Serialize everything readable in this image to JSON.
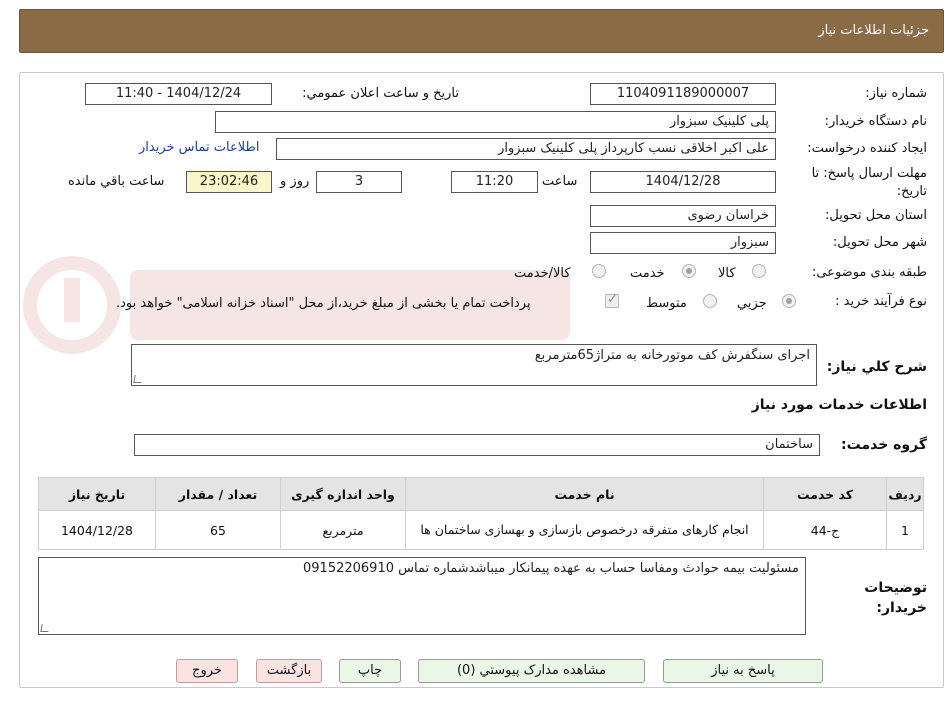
{
  "header": {
    "title": "جزئیات اطلاعات نیاز"
  },
  "fields": {
    "need_number_label": "شماره نیاز:",
    "need_number": "1104091189000007",
    "announce_label": "تاریخ و ساعت اعلان عمومي:",
    "announce_value": "1404/12/24 - 11:40",
    "buyer_org_label": "نام دستگاه خریدار:",
    "buyer_org": "پلی کلینیک سبزوار",
    "requester_label": "ایجاد کننده درخواست:",
    "requester": "علی اکبر اخلاقی نسب کارپرداز پلی کلینیک سبزوار",
    "contact_link": "اطلاعات تماس خریدار",
    "deadline_label": "مهلت ارسال پاسخ: تا تاریخ:",
    "deadline_date": "1404/12/28",
    "time_label": "ساعت",
    "deadline_time": "11:20",
    "days_value": "3",
    "days_label": "روز و",
    "remaining_time": "23:02:46",
    "remaining_label": "ساعت باقي مانده",
    "province_label": "استان محل تحویل:",
    "province": "خراسان رضوی",
    "city_label": "شهر محل تحویل:",
    "city": "سبزوار",
    "category_label": "طبقه بندی موضوعی:",
    "category_options": [
      "کالا",
      "خدمت",
      "کالا/خدمت"
    ],
    "category_selected": "خدمت",
    "process_label": "نوع فرآیند خرید :",
    "process_options": [
      "جزيي",
      "متوسط"
    ],
    "process_selected": "جزيي",
    "payment_note": "پرداخت تمام یا بخشی از مبلغ خرید،از محل \"اسناد خزانه اسلامی\" خواهد بود."
  },
  "summary": {
    "label": "شرح کلي نیاز:",
    "value": "اجرای سنگفرش کف موتورخانه به متراژ65مترمربع"
  },
  "services": {
    "section_title": "اطلاعات خدمات مورد نیاز",
    "group_label": "گروه خدمت:",
    "group_value": "ساختمان",
    "columns": [
      "ردیف",
      "کد خدمت",
      "نام خدمت",
      "واحد اندازه گیری",
      "تعداد / مقدار",
      "تاریخ نیاز"
    ],
    "rows": [
      {
        "row": "1",
        "code": "ج-44",
        "name": "انجام کارهای متفرقه درخصوص بازسازی و بهسازی ساختمان ها",
        "unit": "مترمربع",
        "qty": "65",
        "date": "1404/12/28"
      }
    ]
  },
  "buyer_notes": {
    "label": "توضیحات خریدار:",
    "value": "مسئولیت بیمه حوادث ومفاسا حساب به عهده پیمانکار میباشدشماره تماس 09152206910"
  },
  "buttons": {
    "reply": "پاسخ به نیاز",
    "attachments": "مشاهده مدارک پیوستي (0)",
    "print": "چاپ",
    "back": "بازگشت",
    "exit": "خروج"
  },
  "colors": {
    "header_bg": "#8b6b45",
    "button_green": "#eaf7e7",
    "button_red": "#fbe3e3",
    "link": "#1d3f9a",
    "remaining_bg": "#fbf6c9"
  }
}
